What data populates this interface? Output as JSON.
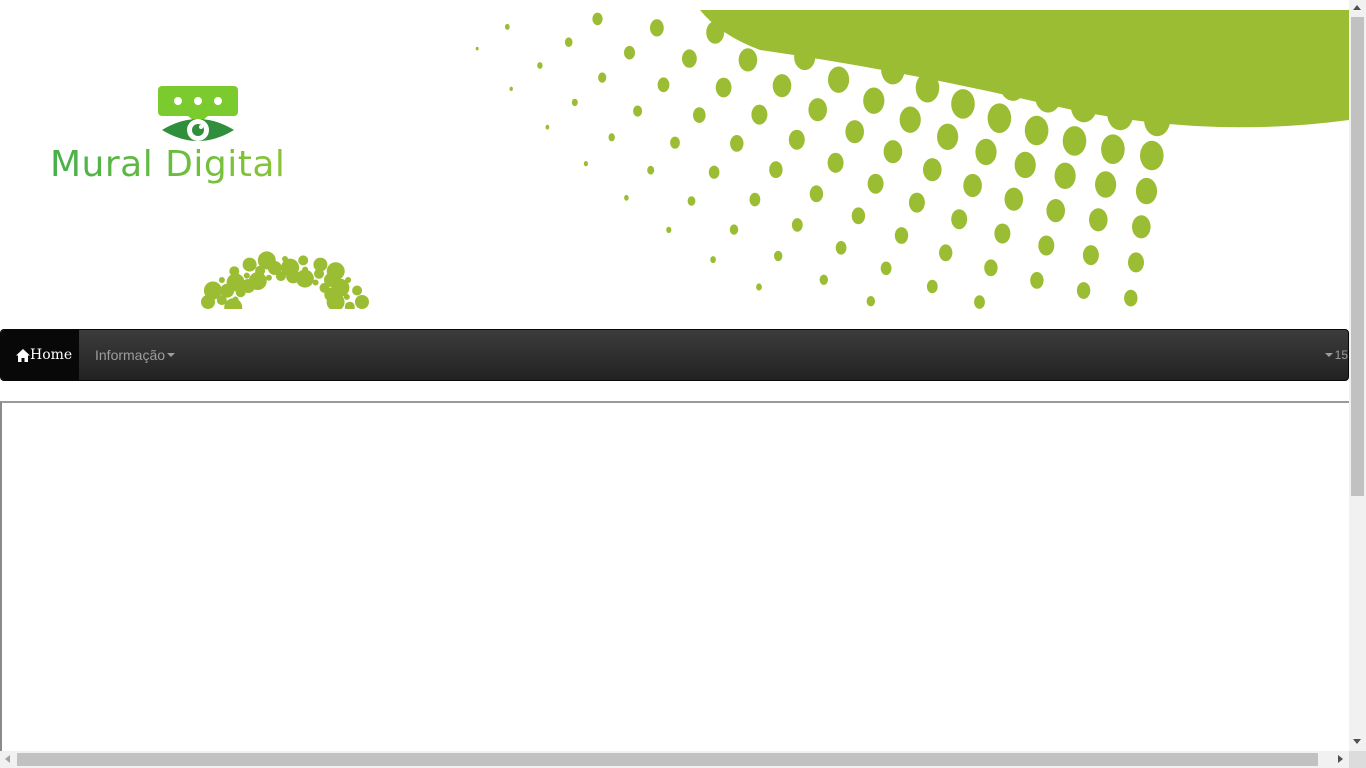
{
  "banner": {
    "logo_text": "Mural Digital",
    "accent_color": "#9bbd33"
  },
  "navbar": {
    "home_label": "Home",
    "info_label": "Informação",
    "right_label": "15"
  },
  "icons": {
    "home": "home-icon",
    "logo": "eye-chat-icon",
    "caret": "caret-down-icon"
  }
}
